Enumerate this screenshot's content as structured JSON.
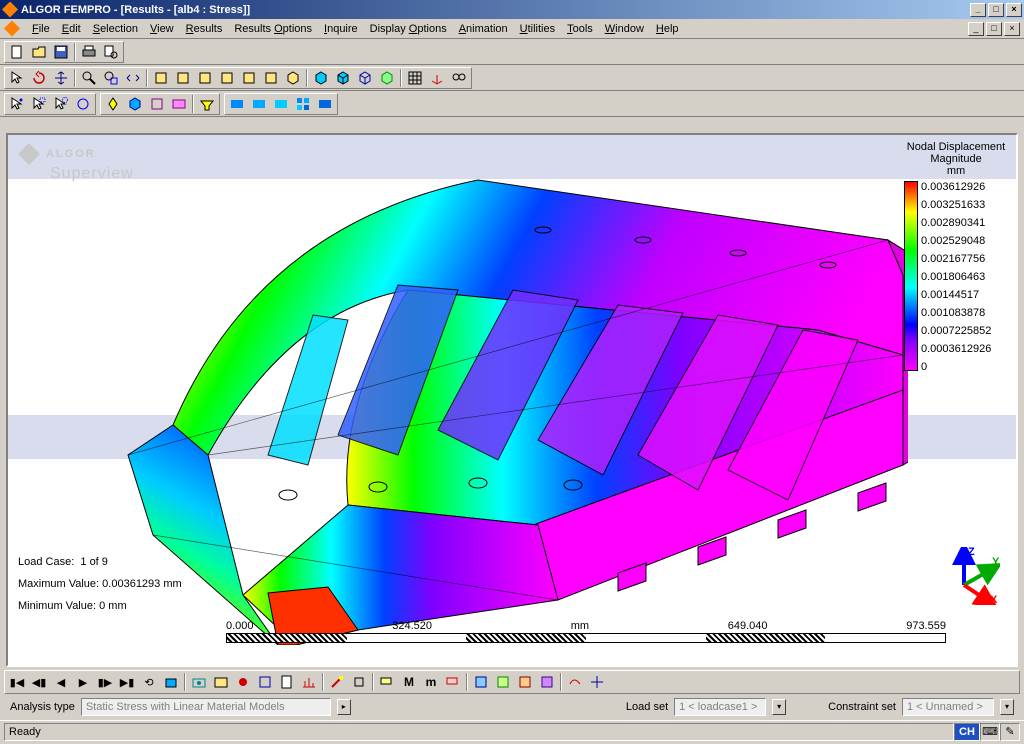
{
  "title": "ALGOR FEMPRO - [Results - [alb4 : Stress]]",
  "menus": [
    "File",
    "Edit",
    "Selection",
    "View",
    "Results",
    "Results Options",
    "Inquire",
    "Display Options",
    "Animation",
    "Utilities",
    "Tools",
    "Window",
    "Help"
  ],
  "menu_accel_index": [
    0,
    0,
    0,
    0,
    0,
    8,
    0,
    8,
    0,
    0,
    0,
    0,
    0
  ],
  "watermark": {
    "brand": "ALGOR",
    "sub": "Superview"
  },
  "legend": {
    "title_l1": "Nodal Displacement",
    "title_l2": "Magnitude",
    "unit": "mm",
    "values": [
      "0.003612926",
      "0.003251633",
      "0.002890341",
      "0.002529048",
      "0.002167756",
      "0.001806463",
      "0.00144517",
      "0.001083878",
      "0.0007225852",
      "0.0003612926",
      "0"
    ]
  },
  "info": {
    "loadcase_label": "Load Case:",
    "loadcase_value": "1 of 9",
    "max_label": "Maximum Value:",
    "max_value": "0.00361293 mm",
    "min_label": "Minimum Value:",
    "min_value": "0 mm"
  },
  "scale": {
    "t0": "0.000",
    "t1": "324.520",
    "unit": "mm",
    "t2": "649.040",
    "t3": "973.559"
  },
  "triad": {
    "x": "X",
    "y": "Y",
    "z": "Z"
  },
  "param": {
    "analysis_label": "Analysis type",
    "analysis_value": "Static Stress with Linear Material Models",
    "loadset_label": "Load set",
    "loadset_value": "1 < loadcase1 >",
    "constraint_label": "Constraint set",
    "constraint_value": "1 < Unnamed >"
  },
  "status": {
    "ready": "Ready",
    "lang": "CH"
  }
}
